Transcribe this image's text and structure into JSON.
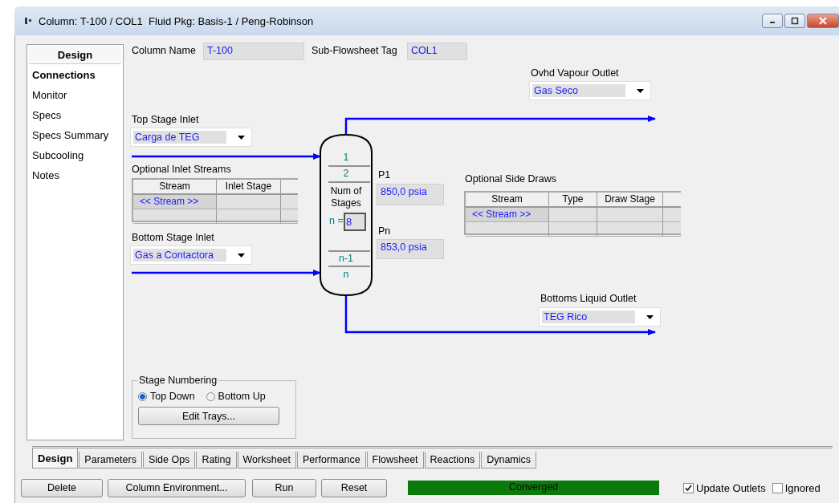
{
  "window": {
    "title": "Column: T-100 / COL1  Fluid Pkg: Basis-1 / Peng-Robinson"
  },
  "sidebar": {
    "title": "Design",
    "items": [
      {
        "label": "Connections",
        "selected": true
      },
      {
        "label": "Monitor",
        "selected": false
      },
      {
        "label": "Specs",
        "selected": false
      },
      {
        "label": "Specs Summary",
        "selected": false
      },
      {
        "label": "Subcooling",
        "selected": false
      },
      {
        "label": "Notes",
        "selected": false
      }
    ]
  },
  "column_name": {
    "label": "Column Name",
    "value": "T-100"
  },
  "subflowsheet_tag": {
    "label": "Sub-Flowsheet Tag",
    "value": "COL1"
  },
  "ovhd_vapour_outlet": {
    "label": "Ovhd Vapour Outlet",
    "value": "Gas Seco"
  },
  "top_stage_inlet": {
    "label": "Top Stage Inlet",
    "value": "Carga de TEG"
  },
  "optional_inlet_streams": {
    "label": "Optional Inlet Streams",
    "columns": [
      "Stream",
      "Inlet Stage"
    ],
    "rows": [
      [
        "<< Stream >>",
        ""
      ]
    ]
  },
  "column": {
    "stages": [
      "1",
      "2"
    ],
    "num_label": "Num of Stages",
    "n_label": "n =",
    "n_value": "8",
    "bottom_stages": [
      "n-1",
      "n"
    ]
  },
  "p1": {
    "label": "P1",
    "value": "850,0 psia"
  },
  "pn": {
    "label": "Pn",
    "value": "853,0 psia"
  },
  "optional_side_draws": {
    "label": "Optional Side Draws",
    "columns": [
      "Stream",
      "Type",
      "Draw Stage"
    ],
    "rows": [
      [
        "<< Stream >>",
        "",
        ""
      ]
    ]
  },
  "bottom_stage_inlet": {
    "label": "Bottom Stage Inlet",
    "value": "Gas a Contactora"
  },
  "bottoms_liquid_outlet": {
    "label": "Bottoms Liquid Outlet",
    "value": "TEG Rico"
  },
  "stage_numbering": {
    "label": "Stage Numbering",
    "options": [
      {
        "label": "Top Down",
        "selected": true
      },
      {
        "label": "Bottom Up",
        "selected": false
      }
    ],
    "button": "Edit Trays..."
  },
  "tabs": [
    {
      "label": "Design",
      "selected": true
    },
    {
      "label": "Parameters",
      "selected": false
    },
    {
      "label": "Side Ops",
      "selected": false
    },
    {
      "label": "Rating",
      "selected": false
    },
    {
      "label": "Worksheet",
      "selected": false
    },
    {
      "label": "Performance",
      "selected": false
    },
    {
      "label": "Flowsheet",
      "selected": false
    },
    {
      "label": "Reactions",
      "selected": false
    },
    {
      "label": "Dynamics",
      "selected": false
    }
  ],
  "buttons": [
    "Delete",
    "Column Environment...",
    "Run",
    "Reset"
  ],
  "status": {
    "label": "Converged",
    "level": 1
  },
  "checkboxes": [
    {
      "label": "Update Outlets",
      "checked": true
    },
    {
      "label": "Ignored",
      "checked": false
    }
  ]
}
